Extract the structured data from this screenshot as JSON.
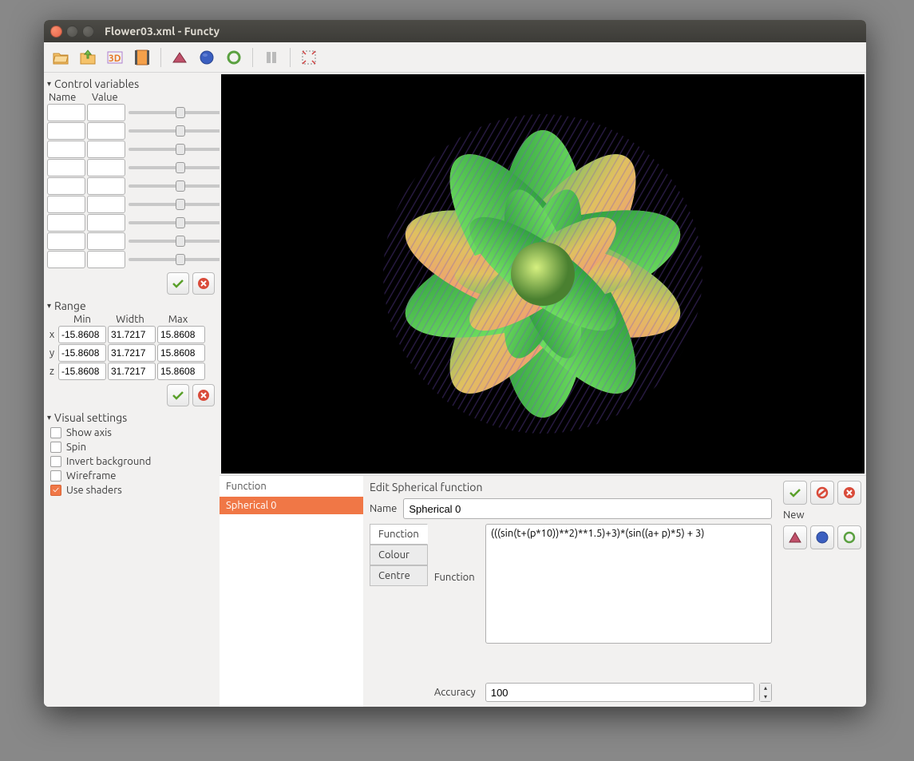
{
  "window": {
    "title": "Flower03.xml - Functy"
  },
  "toolbar": {
    "icons": [
      "open-icon",
      "save-icon",
      "3d-icon",
      "video-icon",
      "cartesian-icon",
      "spherical-icon",
      "curve-icon",
      "pause-icon",
      "fullscreen-icon"
    ]
  },
  "sidebar": {
    "control_vars": {
      "title": "Control variables",
      "name_header": "Name",
      "value_header": "Value",
      "row_count": 9
    },
    "range": {
      "title": "Range",
      "headers": {
        "min": "Min",
        "width": "Width",
        "max": "Max"
      },
      "rows": [
        {
          "axis": "x",
          "min": "-15.8608",
          "width": "31.7217",
          "max": "15.8608"
        },
        {
          "axis": "y",
          "min": "-15.8608",
          "width": "31.7217",
          "max": "15.8608"
        },
        {
          "axis": "z",
          "min": "-15.8608",
          "width": "31.7217",
          "max": "15.8608"
        }
      ]
    },
    "visual": {
      "title": "Visual settings",
      "options": [
        {
          "label": "Show axis",
          "checked": false
        },
        {
          "label": "Spin",
          "checked": false
        },
        {
          "label": "Invert background",
          "checked": false
        },
        {
          "label": "Wireframe",
          "checked": false
        },
        {
          "label": "Use shaders",
          "checked": true
        }
      ]
    }
  },
  "bottom": {
    "function_list": {
      "header": "Function",
      "items": [
        "Spherical 0"
      ],
      "selected_index": 0
    },
    "editor": {
      "title": "Edit Spherical function",
      "name_label": "Name",
      "name_value": "Spherical 0",
      "tabs": [
        "Function",
        "Colour",
        "Centre"
      ],
      "active_tab": 0,
      "function_label": "Function",
      "function_value": "(((sin(t+(p*10))**2)**1.5)+3)*(sin((a+ p)*5) + 3)",
      "accuracy_label": "Accuracy",
      "accuracy_value": "100"
    },
    "right": {
      "new_label": "New"
    }
  },
  "colors": {
    "accent": "#f07746"
  }
}
